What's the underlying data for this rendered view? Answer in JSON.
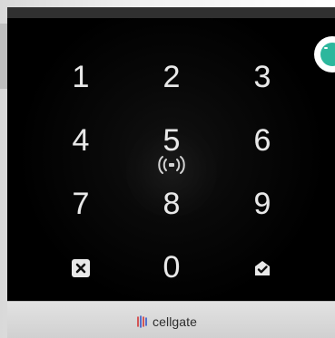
{
  "keypad": {
    "row1": [
      "1",
      "2",
      "3"
    ],
    "row2": [
      "4",
      "5",
      "6"
    ],
    "row3": [
      "7",
      "8",
      "9"
    ],
    "row4_zero": "0",
    "clear_icon": "clear-icon",
    "enter_icon": "confirm-icon"
  },
  "reader": {
    "icon": "nfc-icon"
  },
  "brand": {
    "name": "cellgate",
    "logo_icon": "cellgate-logo-icon"
  },
  "side_control": {
    "icon": "side-accent-icon"
  },
  "colors": {
    "device": "#111111",
    "digit": "#e9e9e9",
    "brand_plate": "#d7d7d7",
    "accent": "#2db79d"
  }
}
